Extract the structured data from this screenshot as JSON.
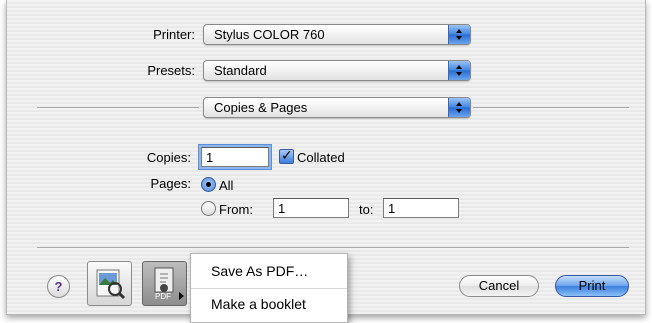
{
  "printer": {
    "label": "Printer:",
    "value": "Stylus COLOR 760"
  },
  "presets": {
    "label": "Presets:",
    "value": "Standard"
  },
  "panel": {
    "value": "Copies & Pages"
  },
  "copies": {
    "label": "Copies:",
    "value": "1",
    "collated_label": "Collated",
    "collated": true
  },
  "pages": {
    "label": "Pages:",
    "all_label": "All",
    "from_label": "From:",
    "from_value": "1",
    "to_label": "to:",
    "to_value": "1",
    "selected": "All"
  },
  "buttons": {
    "help": "?",
    "pdf_badge": "PDF",
    "cancel": "Cancel",
    "print": "Print"
  },
  "pdf_menu": {
    "items": [
      "Save As PDF…",
      "Make a booklet"
    ]
  },
  "colors": {
    "accent": "#3f84e2",
    "help_glyph": "#5a2d8c"
  },
  "icons": [
    "preview-icon",
    "pdf-workflow-icon",
    "help-icon"
  ]
}
